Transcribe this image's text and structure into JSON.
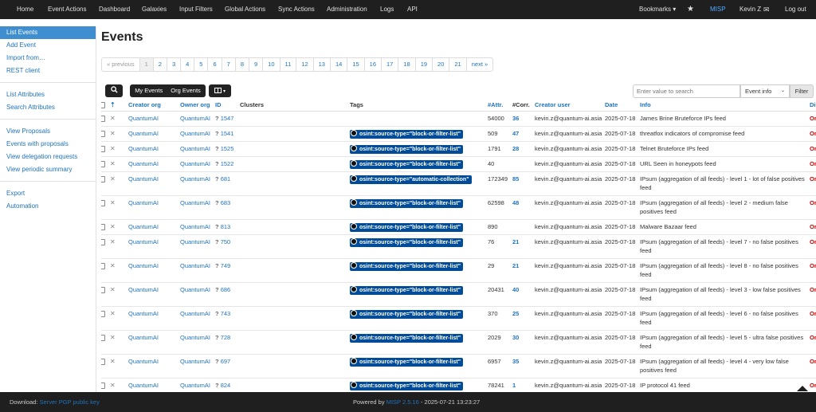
{
  "nav": {
    "left": [
      "Home",
      "Event Actions",
      "Dashboard",
      "Galaxies",
      "Input Filters",
      "Global Actions",
      "Sync Actions",
      "Administration",
      "Logs",
      "API"
    ],
    "bookmarks": "Bookmarks ▾",
    "misp": "MISP",
    "user": "Kevin Z",
    "logout": "Log out"
  },
  "sidebar": {
    "group1": [
      "List Events",
      "Add Event",
      "Import from…",
      "REST client"
    ],
    "group2": [
      "List Attributes",
      "Search Attributes"
    ],
    "group3": [
      "View Proposals",
      "Events with proposals",
      "View delegation requests",
      "View periodic summary"
    ],
    "group4": [
      "Export",
      "Automation"
    ]
  },
  "page_title": "Events",
  "pagination": [
    "« previous",
    "1",
    "2",
    "3",
    "4",
    "5",
    "6",
    "7",
    "8",
    "9",
    "10",
    "11",
    "12",
    "13",
    "14",
    "15",
    "16",
    "17",
    "18",
    "19",
    "20",
    "21",
    "next »"
  ],
  "toolbar": {
    "my_events": "My Events",
    "org_events": "Org Events",
    "search_placeholder": "Enter value to search",
    "search_field": "Event info",
    "filter": "Filter"
  },
  "columns": [
    "Creator org",
    "Owner org",
    "ID",
    "Clusters",
    "Tags",
    "#Attr.",
    "#Corr.",
    "Creator user",
    "Date",
    "Info",
    "Dist"
  ],
  "rows": [
    {
      "creator_org": "QuantumAI",
      "owner_org": "QuantumAI",
      "id": "1547",
      "tag": "",
      "attr": "54000",
      "corr": "36",
      "user": "kevin.z@quantum-ai.asia",
      "date": "2025-07-18",
      "info": "James Brine Bruteforce IPs feed",
      "dist": "Org",
      "tall": false
    },
    {
      "creator_org": "QuantumAI",
      "owner_org": "QuantumAI",
      "id": "1541",
      "tag": "osint:source-type=\"block-or-filter-list\"",
      "attr": "509",
      "corr": "47",
      "user": "kevin.z@quantum-ai.asia",
      "date": "2025-07-18",
      "info": "threatfox indicators of compromise feed",
      "dist": "Org",
      "tall": false
    },
    {
      "creator_org": "QuantumAI",
      "owner_org": "QuantumAI",
      "id": "1525",
      "tag": "osint:source-type=\"block-or-filter-list\"",
      "attr": "1791",
      "corr": "28",
      "user": "kevin.z@quantum-ai.asia",
      "date": "2025-07-18",
      "info": "Telnet Bruteforce IPs feed",
      "dist": "Org",
      "tall": false
    },
    {
      "creator_org": "QuantumAI",
      "owner_org": "QuantumAI",
      "id": "1522",
      "tag": "osint:source-type=\"block-or-filter-list\"",
      "attr": "40",
      "corr": "",
      "user": "kevin.z@quantum-ai.asia",
      "date": "2025-07-18",
      "info": "URL Seen in honeypots feed",
      "dist": "Org",
      "tall": false
    },
    {
      "creator_org": "QuantumAI",
      "owner_org": "QuantumAI",
      "id": "681",
      "tag": "osint:source-type=\"automatic-collection\"",
      "attr": "172349",
      "corr": "85",
      "user": "kevin.z@quantum-ai.asia",
      "date": "2025-07-18",
      "info": "IPsum (aggregation of all feeds) - level 1 - lot of false positives feed",
      "dist": "Org",
      "tall": true
    },
    {
      "creator_org": "QuantumAI",
      "owner_org": "QuantumAI",
      "id": "683",
      "tag": "osint:source-type=\"block-or-filter-list\"",
      "attr": "62598",
      "corr": "48",
      "user": "kevin.z@quantum-ai.asia",
      "date": "2025-07-18",
      "info": "IPsum (aggregation of all feeds) - level 2 - medium false positives feed",
      "dist": "Org",
      "tall": true
    },
    {
      "creator_org": "QuantumAI",
      "owner_org": "QuantumAI",
      "id": "813",
      "tag": "osint:source-type=\"block-or-filter-list\"",
      "attr": "890",
      "corr": "",
      "user": "kevin.z@quantum-ai.asia",
      "date": "2025-07-18",
      "info": "Malware Bazaar feed",
      "dist": "Org",
      "tall": false
    },
    {
      "creator_org": "QuantumAI",
      "owner_org": "QuantumAI",
      "id": "750",
      "tag": "osint:source-type=\"block-or-filter-list\"",
      "attr": "76",
      "corr": "21",
      "user": "kevin.z@quantum-ai.asia",
      "date": "2025-07-18",
      "info": "IPsum (aggregation of all feeds) - level 7 - no false positives feed",
      "dist": "Org",
      "tall": true
    },
    {
      "creator_org": "QuantumAI",
      "owner_org": "QuantumAI",
      "id": "749",
      "tag": "osint:source-type=\"block-or-filter-list\"",
      "attr": "29",
      "corr": "21",
      "user": "kevin.z@quantum-ai.asia",
      "date": "2025-07-18",
      "info": "IPsum (aggregation of all feeds) - level 8 - no false positives feed",
      "dist": "Org",
      "tall": true
    },
    {
      "creator_org": "QuantumAI",
      "owner_org": "QuantumAI",
      "id": "686",
      "tag": "osint:source-type=\"block-or-filter-list\"",
      "attr": "20431",
      "corr": "40",
      "user": "kevin.z@quantum-ai.asia",
      "date": "2025-07-18",
      "info": "IPsum (aggregation of all feeds) - level 3 - low false positives feed",
      "dist": "Org",
      "tall": true
    },
    {
      "creator_org": "QuantumAI",
      "owner_org": "QuantumAI",
      "id": "743",
      "tag": "osint:source-type=\"block-or-filter-list\"",
      "attr": "370",
      "corr": "25",
      "user": "kevin.z@quantum-ai.asia",
      "date": "2025-07-18",
      "info": "IPsum (aggregation of all feeds) - level 6 - no false positives feed",
      "dist": "Org",
      "tall": true
    },
    {
      "creator_org": "QuantumAI",
      "owner_org": "QuantumAI",
      "id": "728",
      "tag": "osint:source-type=\"block-or-filter-list\"",
      "attr": "2029",
      "corr": "30",
      "user": "kevin.z@quantum-ai.asia",
      "date": "2025-07-18",
      "info": "IPsum (aggregation of all feeds) - level 5 - ultra false positives feed",
      "dist": "Org",
      "tall": true
    },
    {
      "creator_org": "QuantumAI",
      "owner_org": "QuantumAI",
      "id": "697",
      "tag": "osint:source-type=\"block-or-filter-list\"",
      "attr": "6957",
      "corr": "35",
      "user": "kevin.z@quantum-ai.asia",
      "date": "2025-07-18",
      "info": "IPsum (aggregation of all feeds) - level 4 - very low false positives feed",
      "dist": "Org",
      "tall": true
    },
    {
      "creator_org": "QuantumAI",
      "owner_org": "QuantumAI",
      "id": "824",
      "tag": "osint:source-type=\"block-or-filter-list\"",
      "attr": "78241",
      "corr": "1",
      "user": "kevin.z@quantum-ai.asia",
      "date": "2025-07-18",
      "info": "IP protocol 41 feed",
      "dist": "Org",
      "tall": false
    }
  ],
  "footer": {
    "download_label": "Download:",
    "download_link": "Server PGP public key",
    "powered_by": "Powered by",
    "misp_version": "MISP 2.5.16",
    "timestamp": "- 2025-07-21 13:23:27"
  }
}
